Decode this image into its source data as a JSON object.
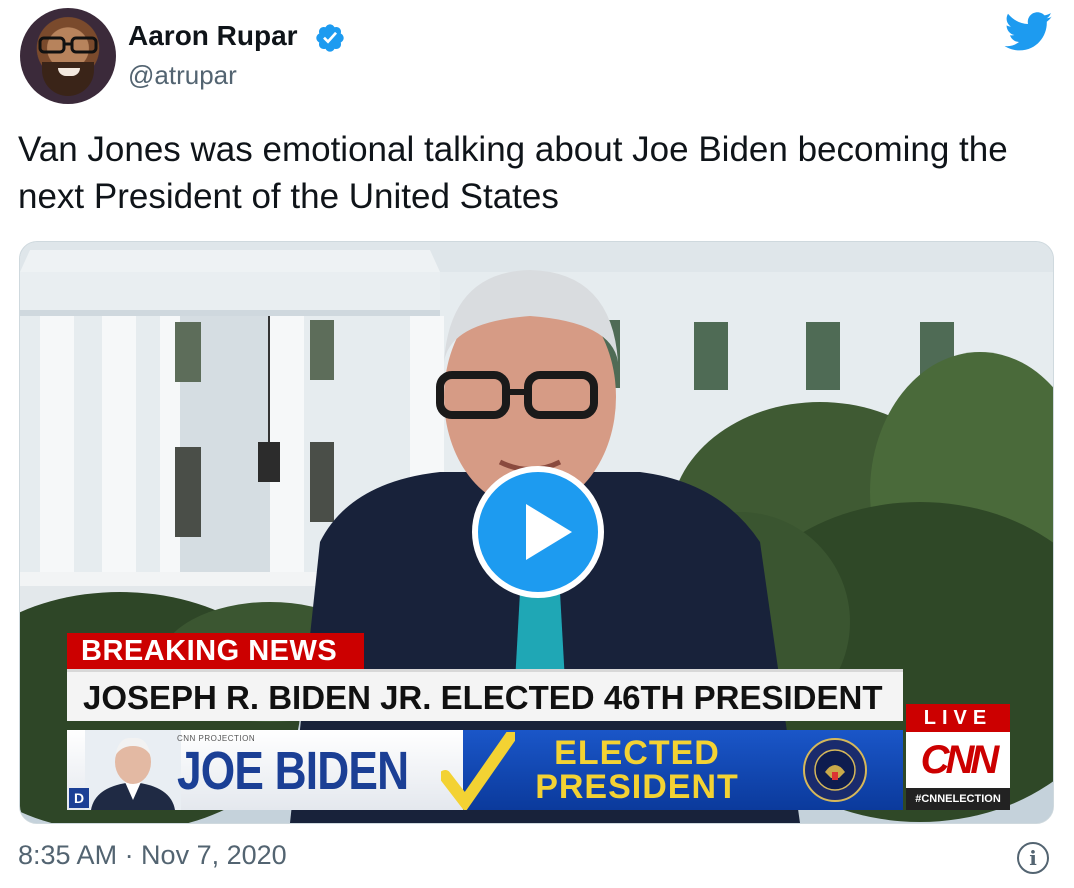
{
  "author": {
    "name": "Aaron Rupar",
    "handle": "@atrupar",
    "verified": true
  },
  "tweet": {
    "text": "Van Jones was emotional talking about Joe Biden becoming the next President of the United States",
    "timestamp": "8:35 AM · Nov 7, 2020"
  },
  "video": {
    "breaking_label": "BREAKING NEWS",
    "headline": "JOSEPH R. BIDEN JR. ELECTED 46TH PRESIDENT",
    "projection_label": "CNN PROJECTION",
    "candidate_name": "JOE BIDEN",
    "elected_line1": "ELECTED",
    "elected_line2": "PRESIDENT",
    "party_badge": "D",
    "live_label": "LIVE",
    "network_logo": "CNN",
    "hashtag": "#CNNELECTION"
  },
  "icons": {
    "platform": "twitter-bird-icon",
    "verified": "verified-badge-icon",
    "play": "play-icon",
    "info": "info-icon"
  },
  "colors": {
    "twitter_blue": "#1d9bf0",
    "cnn_red": "#cc0000",
    "text_secondary": "#536471"
  }
}
